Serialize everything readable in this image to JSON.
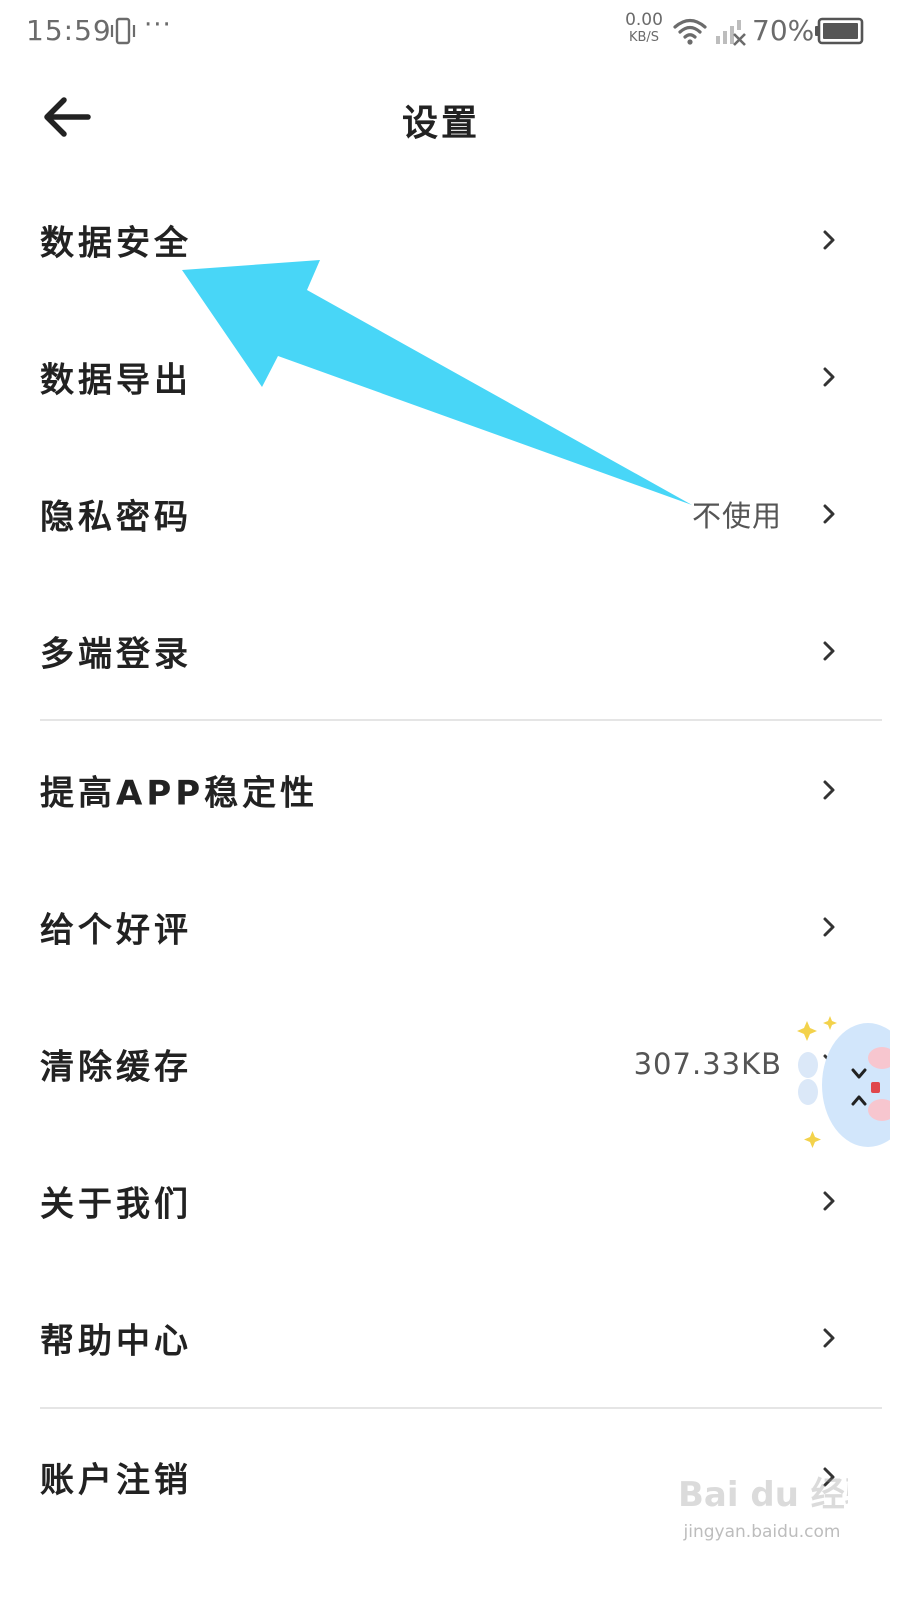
{
  "status_bar": {
    "time": "15:59",
    "more_dots": "···",
    "net_speed_value": "0.00",
    "net_speed_unit": "KB/S",
    "battery_percent": "70%",
    "icons": [
      "vibrate-icon",
      "wifi-icon",
      "signal-off-icon",
      "battery-icon"
    ]
  },
  "header": {
    "title": "设置",
    "back_icon": "arrow-left-icon"
  },
  "settings": {
    "items": [
      {
        "label": "数据安全",
        "value": ""
      },
      {
        "label": "数据导出",
        "value": ""
      },
      {
        "label": "隐私密码",
        "value": "不使用"
      },
      {
        "label": "多端登录",
        "value": ""
      },
      {
        "label": "提高APP稳定性",
        "value": ""
      },
      {
        "label": "给个好评",
        "value": ""
      },
      {
        "label": "清除缓存",
        "value": "307.33KB"
      },
      {
        "label": "关于我们",
        "value": ""
      },
      {
        "label": "帮助中心",
        "value": ""
      },
      {
        "label": "账户注销",
        "value": ""
      }
    ]
  },
  "annotation": {
    "arrow_color": "#48D6F7"
  },
  "watermark": {
    "logo_text": "Bai du 经验",
    "url": "jingyan.baidu.com"
  },
  "colors": {
    "text_primary": "#222222",
    "text_secondary": "#555555",
    "divider": "#e5e5e5",
    "status_text": "#6b6b6b"
  }
}
